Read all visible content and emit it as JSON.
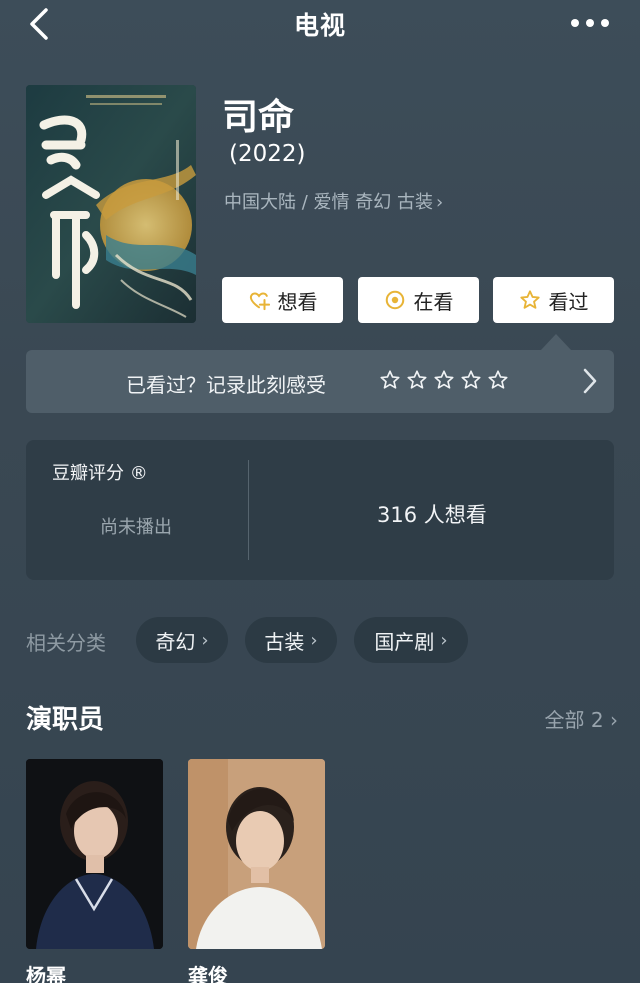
{
  "header": {
    "title": "电视",
    "back_icon": "chevron-left-icon",
    "more_icon": "more-dots-icon"
  },
  "show": {
    "title": "司命",
    "year": "(2022)",
    "meta": "中国大陆 / 爱情 奇幻 古装",
    "meta_chevron": "›"
  },
  "actions": {
    "want": {
      "label": "想看",
      "icon": "heart-plus-icon"
    },
    "watching": {
      "label": "在看",
      "icon": "target-circle-icon"
    },
    "watched": {
      "label": "看过",
      "icon": "star-outline-icon"
    }
  },
  "record": {
    "prompt": "已看过？记录此刻感受",
    "stars": 0,
    "stars_max": 5
  },
  "rating": {
    "label": "豆瓣评分 ®",
    "status": "尚未播出",
    "want_count": "316 人想看"
  },
  "related": {
    "label": "相关分类",
    "chips": [
      {
        "label": "奇幻"
      },
      {
        "label": "古装"
      },
      {
        "label": "国产剧"
      }
    ]
  },
  "cast": {
    "title": "演职员",
    "all_label": "全部 2",
    "members": [
      {
        "name": "杨幂"
      },
      {
        "name": "龚俊"
      }
    ]
  },
  "colors": {
    "background": "#3b4a55",
    "card": "#2f3d47",
    "record_bar": "#4f5e69",
    "accent_gold": "#e8b437"
  }
}
